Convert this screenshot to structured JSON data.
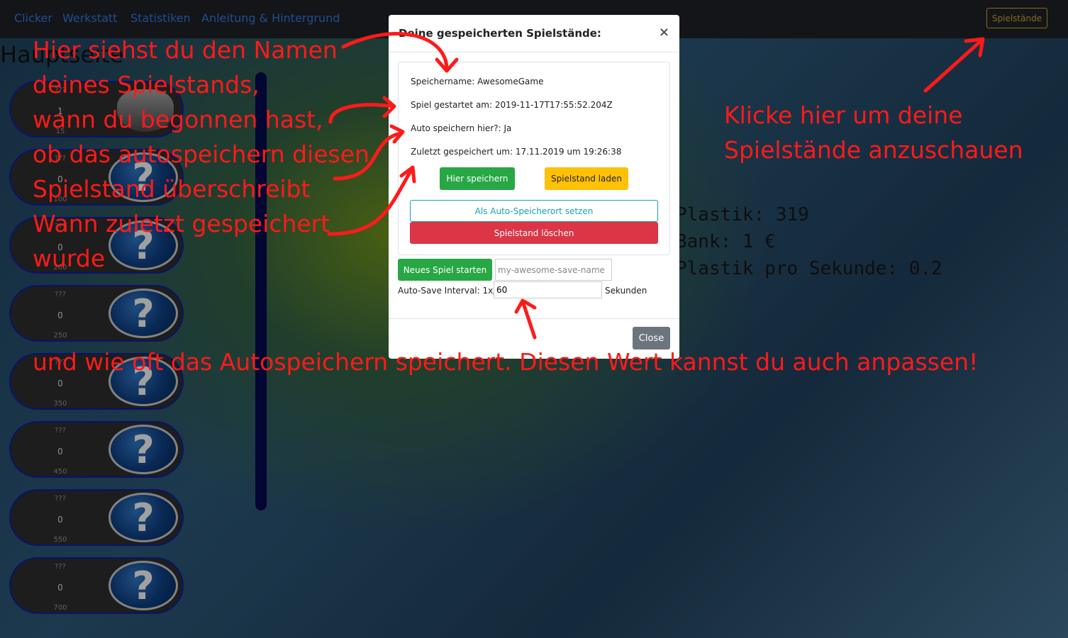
{
  "nav": {
    "links": [
      "Clicker",
      "Werkstatt",
      "Statistiken",
      "Anleitung & Hintergrund"
    ],
    "saves_button": "Spielstände"
  },
  "page": {
    "title": "Hauptseite"
  },
  "items": [
    {
      "name": "??? ",
      "count": "1",
      "price": "15"
    },
    {
      "name": "???",
      "count": "0",
      "price": "100"
    },
    {
      "name": "???",
      "count": "0",
      "price": "200"
    },
    {
      "name": "???",
      "count": "0",
      "price": "250"
    },
    {
      "name": "???",
      "count": "0",
      "price": "350"
    },
    {
      "name": "???",
      "count": "0",
      "price": "450"
    },
    {
      "name": "???",
      "count": "0",
      "price": "550"
    },
    {
      "name": "???",
      "count": "0",
      "price": "700"
    }
  ],
  "stats": {
    "plastik": "Plastik: 319",
    "bank": "Bank: 1 €",
    "per_second": "Plastik pro Sekunde: 0.2"
  },
  "modal": {
    "title": "Deine gespeicherten Spielstände:",
    "close_x": "×",
    "save_name": "Speichername: AwesomeGame",
    "started": "Spiel gestartet am: 2019-11-17T17:55:52.204Z",
    "auto_save_here": "Auto speichern hier?: Ja",
    "last_saved": "Zuletzt gespeichert um: 17.11.2019 um 19:26:38",
    "btn_save_here": "Hier speichern",
    "btn_load": "Spielstand laden",
    "btn_set_auto": "Als Auto-Speicherort setzen",
    "btn_delete": "Spielstand löschen",
    "btn_new_game": "Neues Spiel starten",
    "new_name_placeholder": "my-awesome-save-name",
    "interval_label": "Auto-Save Interval: 1x/",
    "interval_value": "60",
    "interval_unit": "Sekunden",
    "btn_close": "Close"
  },
  "annotations": {
    "left_block": "Hier siehst du den Namen\ndeines Spielstands,\nwann du begonnen hast,\nob das autospeichern diesen\nSpielstand überschreibt\nWann zuletzt gespeichert\nwurde",
    "right_block": "Klicke hier um deine\nSpielstände anzuschauen",
    "bottom_line": "und wie oft das Autospeichern speichert. Diesen Wert kannst du auch anpassen!"
  },
  "colors": {
    "annotation": "#ff1a1a",
    "nav_link": "#2f6fd0",
    "saves_button": "#c79a2a"
  }
}
